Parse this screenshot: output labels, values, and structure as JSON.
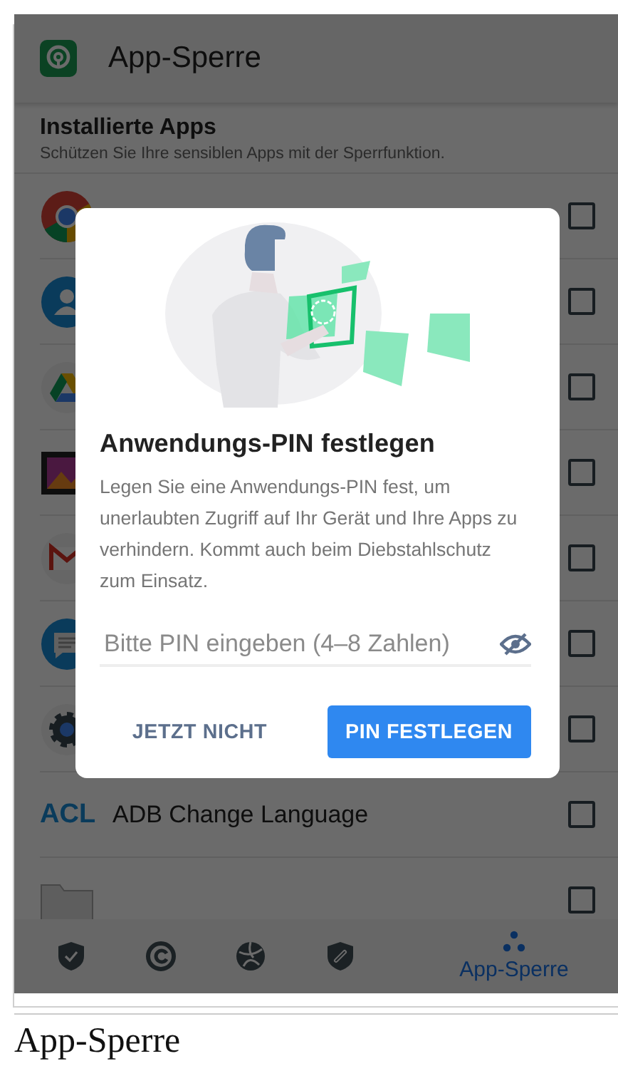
{
  "app_bar": {
    "title": "App-Sperre"
  },
  "section": {
    "title": "Installierte Apps",
    "subtitle": "Schützen Sie Ihre sensiblen Apps mit der Sperrfunktion."
  },
  "apps": [
    {
      "kind": "chrome",
      "checked": false
    },
    {
      "kind": "contacts",
      "checked": false
    },
    {
      "kind": "drive",
      "checked": false
    },
    {
      "kind": "gallery",
      "checked": false
    },
    {
      "kind": "mail",
      "checked": false
    },
    {
      "kind": "messages",
      "checked": false
    },
    {
      "kind": "settings",
      "checked": false
    },
    {
      "kind": "acl",
      "icon_text": "ACL",
      "name": "ADB Change Language",
      "checked": false
    },
    {
      "kind": "folder",
      "checked": false
    }
  ],
  "dialog": {
    "title": "Anwendungs-PIN festlegen",
    "body": "Legen Sie eine Anwendungs-PIN fest, um unerlaubten Zugriff auf Ihr Gerät und Ihre Apps zu verhindern. Kommt auch beim Diebstahlschutz zum Einsatz.",
    "pin_field": {
      "placeholder": "Bitte PIN eingeben (4–8 Zahlen)"
    },
    "buttons": [
      {
        "kind": "text",
        "label": "JETZT NICHT"
      },
      {
        "kind": "primary",
        "label": "PIN FESTLEGEN"
      }
    ]
  },
  "nav": [
    {
      "kind": "shield-check",
      "selected": false
    },
    {
      "kind": "circle-c",
      "selected": false
    },
    {
      "kind": "ball",
      "selected": false
    },
    {
      "kind": "shield-link",
      "selected": false
    },
    {
      "kind": "dots",
      "label": "App-Sperre",
      "selected": true
    }
  ],
  "caption": "App-Sperre"
}
